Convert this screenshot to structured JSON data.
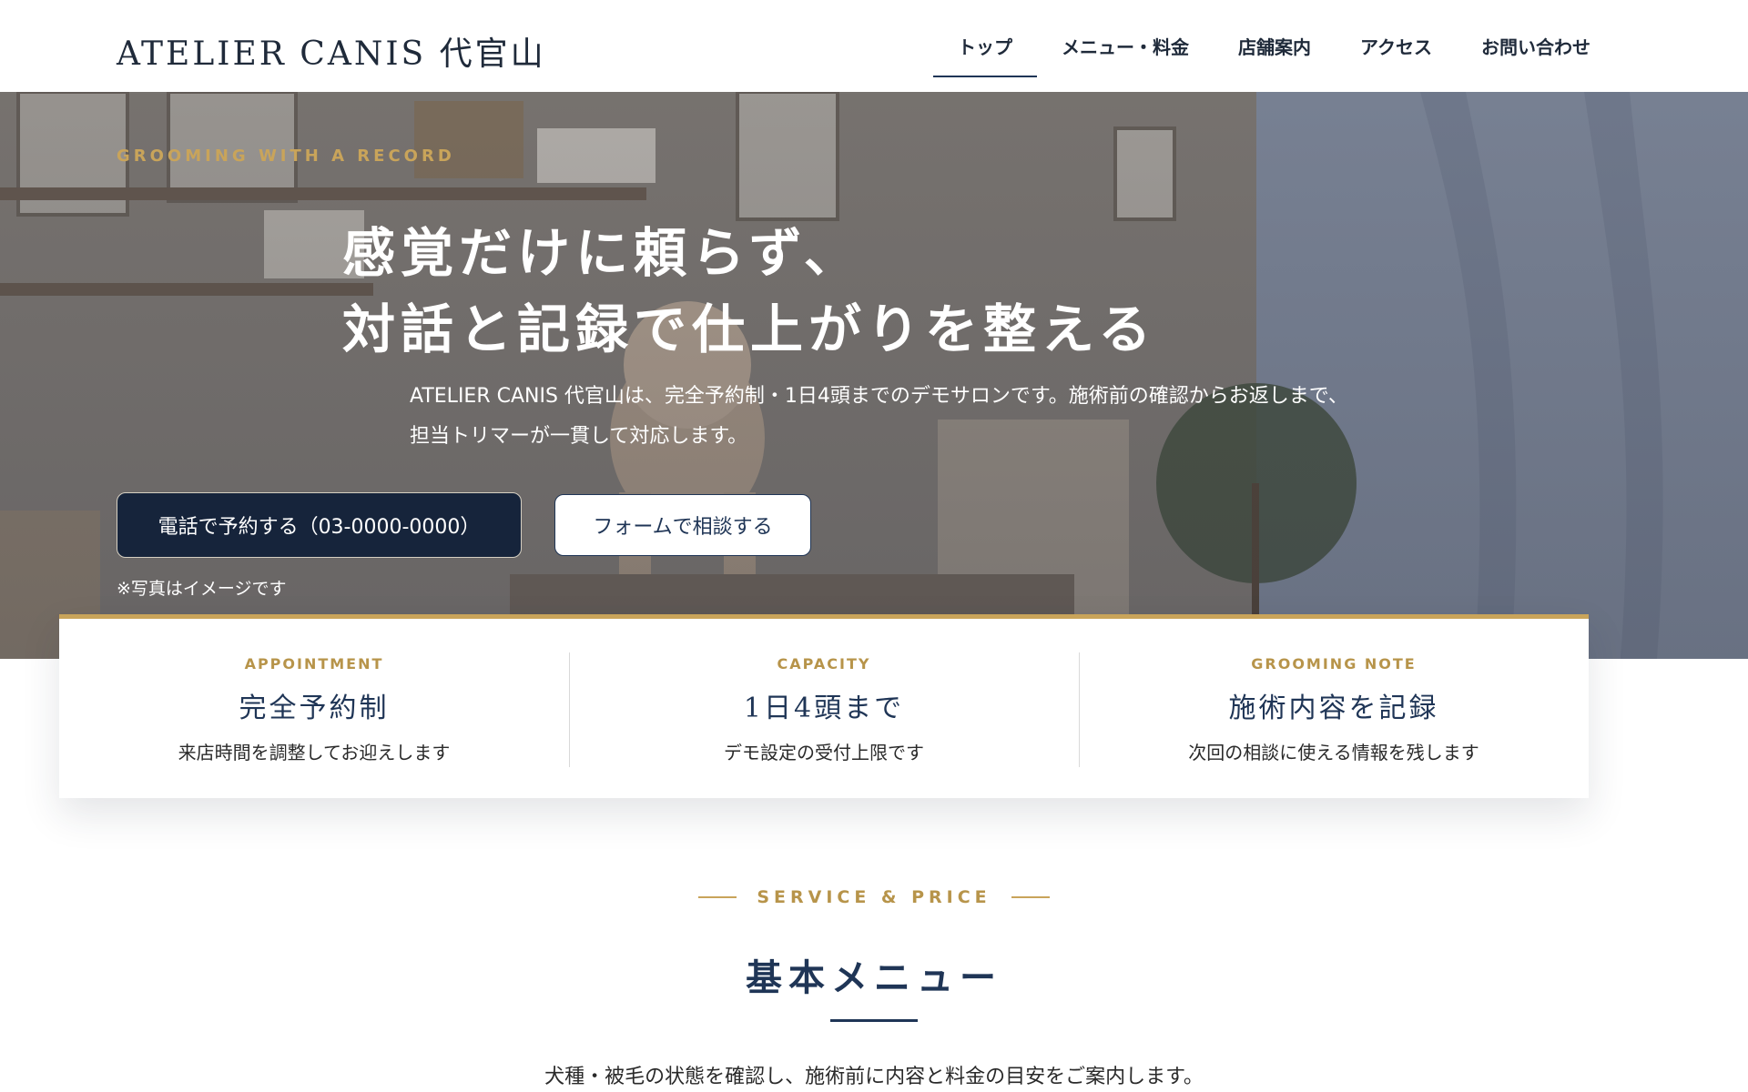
{
  "header": {
    "logo": "ATELIER CANIS 代官山",
    "nav": [
      {
        "label": "トップ"
      },
      {
        "label": "メニュー・料金"
      },
      {
        "label": "店舗案内"
      },
      {
        "label": "アクセス"
      },
      {
        "label": "お問い合わせ"
      }
    ],
    "active_nav": "トップ"
  },
  "hero": {
    "eyebrow": "GROOMING WITH A RECORD",
    "title_line1": "感覚だけに頼らず、",
    "title_line2": "対話と記録で仕上がりを整える",
    "description": "ATELIER CANIS 代官山は、完全予約制・1日4頭までのデモサロンです。施術前の確認からお返しまで、担当トリマーが一貫して対応します。",
    "primary_button": "電話で予約する（03-0000-0000）",
    "secondary_button": "フォームで相談する",
    "photo_note": "※写真はイメージです"
  },
  "features": [
    {
      "eyebrow": "APPOINTMENT",
      "title": "完全予約制",
      "desc": "来店時間を調整してお迎えします"
    },
    {
      "eyebrow": "CAPACITY",
      "title": "1日4頭まで",
      "desc": "デモ設定の受付上限です"
    },
    {
      "eyebrow": "GROOMING NOTE",
      "title": "施術内容を記録",
      "desc": "次回の相談に使える情報を残します"
    }
  ],
  "section": {
    "eyebrow": "SERVICE & PRICE",
    "title": "基本メニュー",
    "lead": "犬種・被毛の状態を確認し、施術前に内容と料金の目安をご案内します。"
  },
  "colors": {
    "navy": "#1f3556",
    "gold": "#c9a45a",
    "button_dark": "#16243b"
  }
}
